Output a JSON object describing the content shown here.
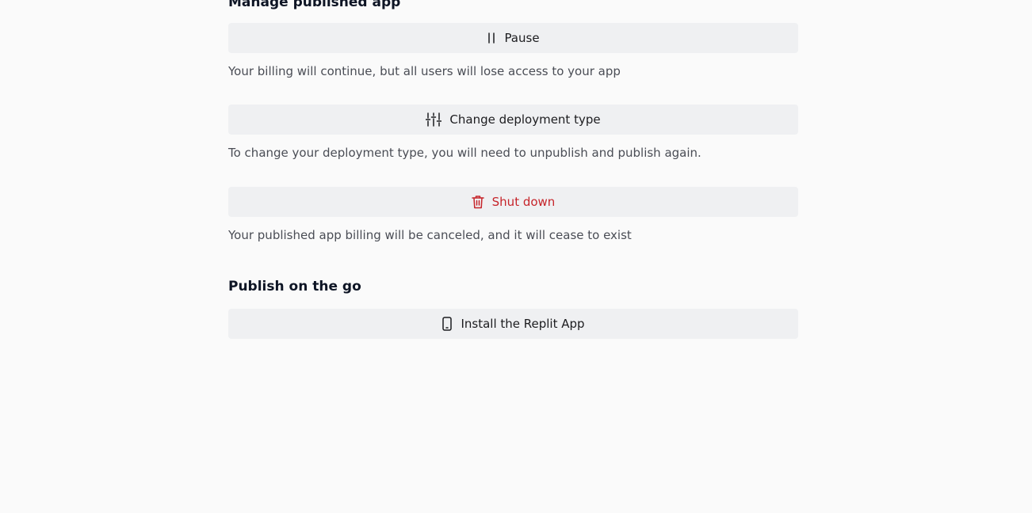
{
  "manage": {
    "title": "Manage published app",
    "pause": {
      "label": "Pause",
      "icon": "pause-icon",
      "description": "Your billing will continue, but all users will lose access to your app"
    },
    "change_type": {
      "label": "Change deployment type",
      "icon": "sliders-icon",
      "description": "To change your deployment type, you will need to unpublish and publish again."
    },
    "shutdown": {
      "label": "Shut down",
      "icon": "trash-icon",
      "description": "Your published app billing will be canceled, and it will cease to exist"
    }
  },
  "on_the_go": {
    "title": "Publish on the go",
    "install": {
      "label": "Install the Replit App",
      "icon": "phone-icon"
    }
  },
  "colors": {
    "background": "#fafafa",
    "button_bg": "#eff0f2",
    "danger": "#c6242a",
    "muted_text": "#4a4d55"
  }
}
